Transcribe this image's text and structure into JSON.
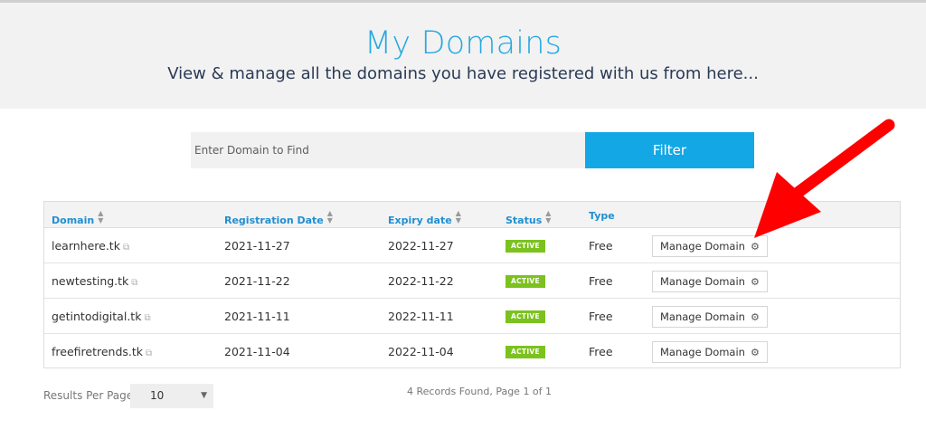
{
  "header": {
    "title": "My Domains",
    "subtitle": "View & manage all the domains you have registered with us from here..."
  },
  "search": {
    "placeholder": "Enter Domain to Find",
    "value": "",
    "filter_label": "Filter"
  },
  "table": {
    "columns": [
      "Domain",
      "Registration Date",
      "Expiry date",
      "Status",
      "Type"
    ],
    "rows": [
      {
        "domain": "learnhere.tk",
        "registration_date": "2021-11-27",
        "expiry_date": "2022-11-27",
        "status": "ACTIVE",
        "type": "Free",
        "action": "Manage Domain"
      },
      {
        "domain": "newtesting.tk",
        "registration_date": "2021-11-22",
        "expiry_date": "2022-11-22",
        "status": "ACTIVE",
        "type": "Free",
        "action": "Manage Domain"
      },
      {
        "domain": "getintodigital.tk",
        "registration_date": "2021-11-11",
        "expiry_date": "2022-11-11",
        "status": "ACTIVE",
        "type": "Free",
        "action": "Manage Domain"
      },
      {
        "domain": "freefiretrends.tk",
        "registration_date": "2021-11-04",
        "expiry_date": "2022-11-04",
        "status": "ACTIVE",
        "type": "Free",
        "action": "Manage Domain"
      }
    ]
  },
  "footer": {
    "results_per_page_label": "Results Per Page:",
    "results_per_page_value": "10",
    "records_summary": "4 Records Found, Page 1 of 1"
  },
  "colors": {
    "accent": "#14a7e6",
    "title": "#26a9e0",
    "status_active": "#7cc21f",
    "annotation_arrow": "#ff0000"
  },
  "icons": {
    "sort": "sort-icon",
    "external_link": "external-link-icon",
    "manage": "gear-icon",
    "dropdown": "caret-down-icon"
  }
}
